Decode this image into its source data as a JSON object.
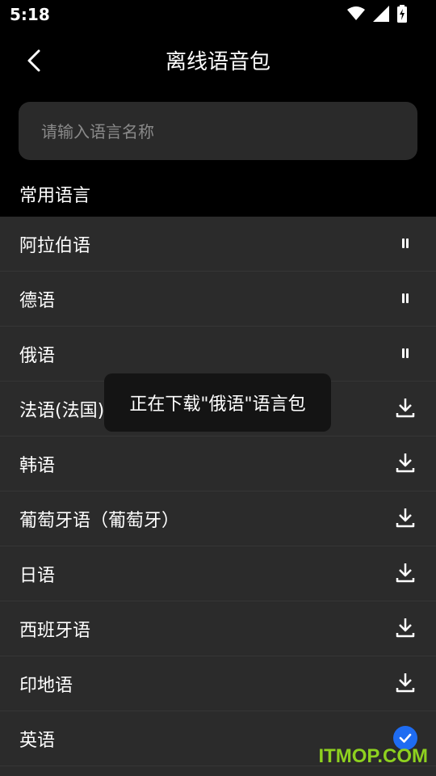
{
  "status_bar": {
    "time": "5:18"
  },
  "header": {
    "title": "离线语音包"
  },
  "search": {
    "placeholder": "请输入语言名称",
    "value": ""
  },
  "section": {
    "title": "常用语言"
  },
  "languages": [
    {
      "label": "阿拉伯语",
      "state": "paused",
      "icon": "pause-icon"
    },
    {
      "label": "德语",
      "state": "paused",
      "icon": "pause-icon"
    },
    {
      "label": "俄语",
      "state": "paused",
      "icon": "pause-icon"
    },
    {
      "label": "法语(法国)",
      "state": "not-downloaded",
      "icon": "download-icon"
    },
    {
      "label": "韩语",
      "state": "not-downloaded",
      "icon": "download-icon"
    },
    {
      "label": "葡萄牙语（葡萄牙）",
      "state": "not-downloaded",
      "icon": "download-icon"
    },
    {
      "label": "日语",
      "state": "not-downloaded",
      "icon": "download-icon"
    },
    {
      "label": "西班牙语",
      "state": "not-downloaded",
      "icon": "download-icon"
    },
    {
      "label": "印地语",
      "state": "not-downloaded",
      "icon": "download-icon"
    },
    {
      "label": "英语",
      "state": "downloaded",
      "icon": "check-icon"
    }
  ],
  "toast": {
    "message": "正在下载\"俄语\"语言包"
  },
  "watermark": {
    "text": "ITMOP.COM"
  },
  "colors": {
    "background": "#000000",
    "list_background": "#2b2b2b",
    "search_background": "#2a2a2a",
    "pause_icon": "#9aa4bd",
    "check_icon": "#1e6cf2",
    "watermark": "#8ed11f"
  }
}
